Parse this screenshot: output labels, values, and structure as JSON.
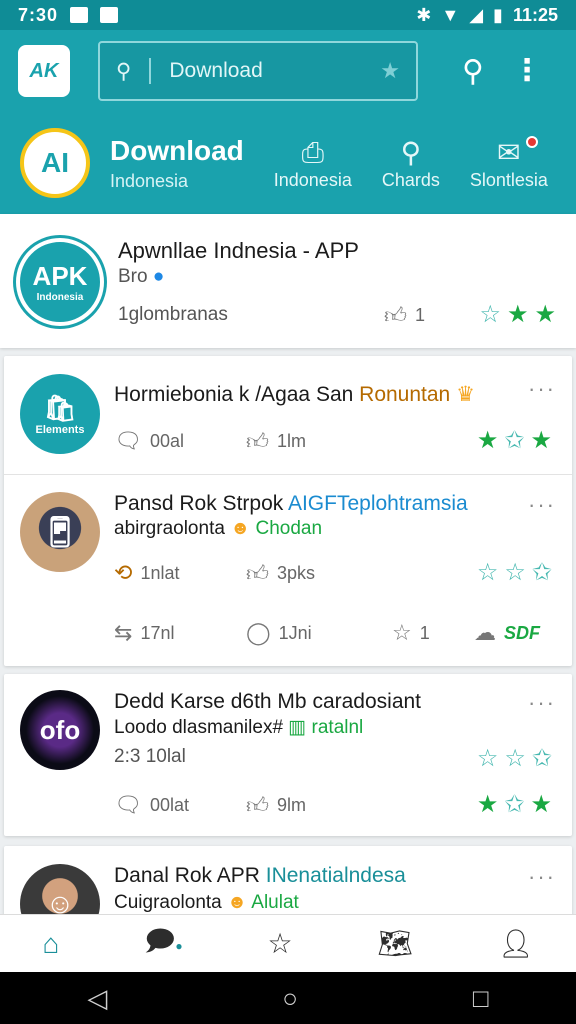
{
  "status_bar": {
    "time": "7:30",
    "right_time": "11:25"
  },
  "app_bar": {
    "search_placeholder": "Download"
  },
  "brand": {
    "title": "Download",
    "subtitle": "Indonesia",
    "logo_text": "AI"
  },
  "categories": [
    {
      "label": "Indonesia",
      "icon": "download-box-icon"
    },
    {
      "label": "Chards",
      "icon": "search-icon"
    },
    {
      "label": "Slontlesia",
      "icon": "message-icon"
    }
  ],
  "app_header": {
    "title": "Apwnllae Indnesia - APP",
    "subtitle": "Bro",
    "stat_text": "1glombranas",
    "likes": "1",
    "logo_text": "APK",
    "logo_sub": "Indonesia"
  },
  "feed": [
    {
      "title": "Hormiebonia k /Agaa San",
      "tag": "Ronuntan",
      "comments": "00al",
      "likes": "1lm",
      "avatar_text": "Elements"
    },
    {
      "title": "Pansd Rok Strpok",
      "tag": "AIGFTeplohtramsia",
      "line2": "abirgraolonta",
      "line2_tag": "Chodan",
      "reposts": "1nlat",
      "likes": "3pks",
      "comments2": "17nl",
      "comments3": "1Jni",
      "stars": "1",
      "share": "SDF"
    },
    {
      "title": "Dedd Karse d6th Mb caradosiant",
      "line2": "Loodo dlasmanilex#",
      "line2_tag": "ratalnl",
      "line3": "2:3 10lal",
      "comments": "00lat",
      "likes": "9lm",
      "avatar_text": "ofo"
    },
    {
      "title": "Danal Rok APR",
      "tag": "INenatialndesa",
      "line2": "Cuigraolonta",
      "line2_tag": "Alulat"
    }
  ]
}
